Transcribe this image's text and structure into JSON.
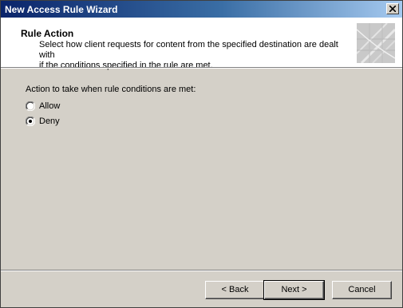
{
  "window": {
    "title": "New Access Rule Wizard"
  },
  "header": {
    "title": "Rule Action",
    "description_line1": "Select how client requests for content from the specified destination are dealt with",
    "description_line2": "if the conditions specified in the rule are met."
  },
  "main": {
    "action_label": "Action to take when rule conditions are met:",
    "options": [
      {
        "label": "Allow",
        "selected": false
      },
      {
        "label": "Deny",
        "selected": true
      }
    ]
  },
  "footer": {
    "back_label": "< Back",
    "next_label": "Next >",
    "cancel_label": "Cancel"
  },
  "colors": {
    "titlebar_start": "#0a246a",
    "titlebar_end": "#a6caf0",
    "dialog_face": "#d4d0c8",
    "header_bg": "#ffffff"
  },
  "icons": {
    "close": "close-icon",
    "header_graphic": "wizard-banner-graphic"
  }
}
